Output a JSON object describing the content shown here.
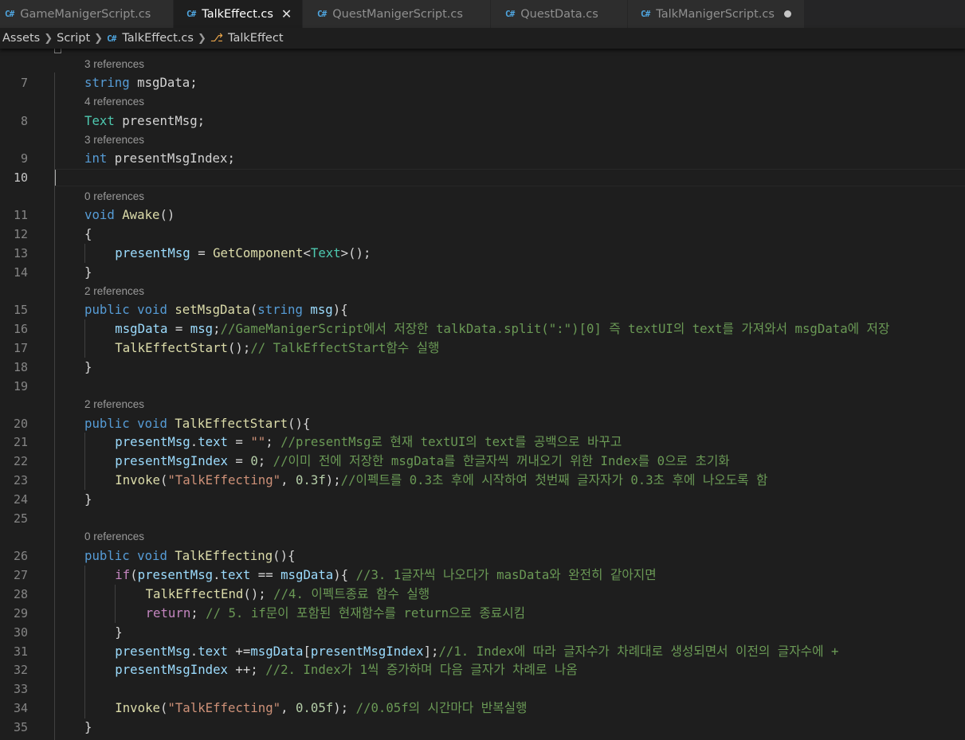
{
  "tabs": [
    {
      "label": "GameManigerScript.cs",
      "active": false
    },
    {
      "label": "TalkEffect.cs",
      "active": true
    },
    {
      "label": "QuestManigerScript.cs",
      "active": false
    },
    {
      "label": "QuestData.cs",
      "active": false
    },
    {
      "label": "TalkManigerScript.cs",
      "active": false,
      "modified": true
    }
  ],
  "breadcrumb": {
    "assets": "Assets",
    "script": "Script",
    "file": "TalkEffect.cs",
    "symbol": "TalkEffect"
  },
  "colors": {
    "keyword": "#569cd6",
    "control": "#c586c0",
    "type": "#4ec9b0",
    "function": "#dcdcaa",
    "variable": "#9cdcfe",
    "string": "#ce9178",
    "number": "#b5cea8",
    "comment": "#6a9955"
  },
  "editor": {
    "current_line": 10,
    "lens": [
      "3 references",
      "4 references",
      "3 references",
      "0 references",
      "2 references",
      "2 references",
      "0 references"
    ],
    "line_numbers": [
      "7",
      "8",
      "9",
      "10",
      "11",
      "12",
      "13",
      "14",
      "15",
      "16",
      "17",
      "18",
      "19",
      "20",
      "21",
      "22",
      "23",
      "24",
      "25",
      "26",
      "27",
      "28",
      "29",
      "30",
      "31",
      "32",
      "33",
      "34",
      "35"
    ],
    "lines": [
      [
        [
          "kw",
          "string"
        ],
        [
          "",
          "msgData;"
        ]
      ],
      [
        [
          "ty",
          "Text"
        ],
        [
          "",
          "presentMsg;"
        ]
      ],
      [
        [
          "kw",
          "int"
        ],
        [
          "",
          "presentMsgIndex;"
        ]
      ],
      [],
      [
        [
          "kw",
          "void"
        ],
        [
          "fn",
          "Awake"
        ],
        [
          "",
          "()"
        ]
      ],
      [
        [
          "",
          "{"
        ]
      ],
      [
        [
          "vr",
          "presentMsg"
        ],
        [
          "",
          " = "
        ],
        [
          "fn",
          "GetComponent"
        ],
        [
          "",
          "<"
        ],
        [
          "ty",
          "Text"
        ],
        [
          "",
          ">();"
        ]
      ],
      [
        [
          "",
          "}"
        ]
      ],
      [
        [
          "kw",
          "public"
        ],
        [
          "kw",
          "void"
        ],
        [
          "fn",
          "setMsgData"
        ],
        [
          "",
          "("
        ],
        [
          "kw",
          "string"
        ],
        [
          "vr",
          "msg"
        ],
        [
          "",
          ")"
        ],
        [
          "",
          "{"
        ]
      ],
      [
        [
          "vr",
          "msgData"
        ],
        [
          "",
          " = "
        ],
        [
          "vr",
          "msg"
        ],
        [
          "",
          ";"
        ],
        [
          "cm",
          "//GameManigerScript에서 저장한 talkData.split(\":\")[0] 즉 textUI의 text를 가져와서 msgData에 저장"
        ]
      ],
      [
        [
          "fn",
          "TalkEffectStart"
        ],
        [
          "",
          "();"
        ],
        [
          "cm",
          "// TalkEffectStart함수 실행"
        ]
      ],
      [
        [
          "",
          "}"
        ]
      ],
      [],
      [
        [
          "kw",
          "public"
        ],
        [
          "kw",
          "void"
        ],
        [
          "fn",
          "TalkEffectStart"
        ],
        [
          "",
          "(){"
        ]
      ],
      [
        [
          "vr",
          "presentMsg"
        ],
        [
          "",
          "."
        ],
        [
          "vr",
          "text"
        ],
        [
          "",
          " = "
        ],
        [
          "st",
          "\"\""
        ],
        [
          "",
          "; "
        ],
        [
          "cm",
          "//presentMsg로 현재 textUI의 text를 공백으로 바꾸고"
        ]
      ],
      [
        [
          "vr",
          "presentMsgIndex"
        ],
        [
          "",
          " = "
        ],
        [
          "nm",
          "0"
        ],
        [
          "",
          "; "
        ],
        [
          "cm",
          "//이미 전에 저장한 msgData를 한글자씩 꺼내오기 위한 Index를 0으로 초기화"
        ]
      ],
      [
        [
          "fn",
          "Invoke"
        ],
        [
          "",
          "("
        ],
        [
          "st",
          "\"TalkEffecting\""
        ],
        [
          "",
          ", "
        ],
        [
          "nm",
          "0.3f"
        ],
        [
          "",
          ");"
        ],
        [
          "cm",
          "//이펙트를 0.3초 후에 시작하여 첫번째 글자자가 0.3초 후에 나오도록 함"
        ]
      ],
      [
        [
          "",
          "}"
        ]
      ],
      [],
      [
        [
          "kw",
          "public"
        ],
        [
          "kw",
          "void"
        ],
        [
          "fn",
          "TalkEffecting"
        ],
        [
          "",
          "(){"
        ]
      ],
      [
        [
          "ctl",
          "if"
        ],
        [
          "",
          "("
        ],
        [
          "vr",
          "presentMsg"
        ],
        [
          "",
          "."
        ],
        [
          "vr",
          "text"
        ],
        [
          "",
          " == "
        ],
        [
          "vr",
          "msgData"
        ],
        [
          "",
          "){ "
        ],
        [
          "cm",
          "//3. 1글자씩 나오다가 masData와 완전히 같아지면"
        ]
      ],
      [
        [
          "fn",
          "TalkEffectEnd"
        ],
        [
          "",
          "(); "
        ],
        [
          "cm",
          "//4. 이펙트종료 함수 실행"
        ]
      ],
      [
        [
          "ctl",
          "return"
        ],
        [
          "",
          "; "
        ],
        [
          "cm",
          "// 5. if문이 포함된 현재함수를 return으로 종료시킴"
        ]
      ],
      [
        [
          "",
          "}"
        ]
      ],
      [
        [
          "vr",
          "presentMsg"
        ],
        [
          "",
          "."
        ],
        [
          "vr",
          "text"
        ],
        [
          "",
          " +="
        ],
        [
          "vr",
          "msgData"
        ],
        [
          "",
          "["
        ],
        [
          "vr",
          "presentMsgIndex"
        ],
        [
          "",
          "];"
        ],
        [
          "cm",
          "//1. Index에 따라 글자수가 차례대로 생성되면서 이전의 글자수에 +"
        ]
      ],
      [
        [
          "vr",
          "presentMsgIndex"
        ],
        [
          "",
          " ++; "
        ],
        [
          "cm",
          "//2. Index가 1씩 증가하며 다음 글자가 차례로 나옴"
        ]
      ],
      [],
      [
        [
          "fn",
          "Invoke"
        ],
        [
          "",
          "("
        ],
        [
          "st",
          "\"TalkEffecting\""
        ],
        [
          "",
          ", "
        ],
        [
          "nm",
          "0.05f"
        ],
        [
          "",
          "); "
        ],
        [
          "cm",
          "//0.05f의 시간마다 반복실행"
        ]
      ],
      [
        [
          "",
          "}"
        ]
      ]
    ]
  }
}
